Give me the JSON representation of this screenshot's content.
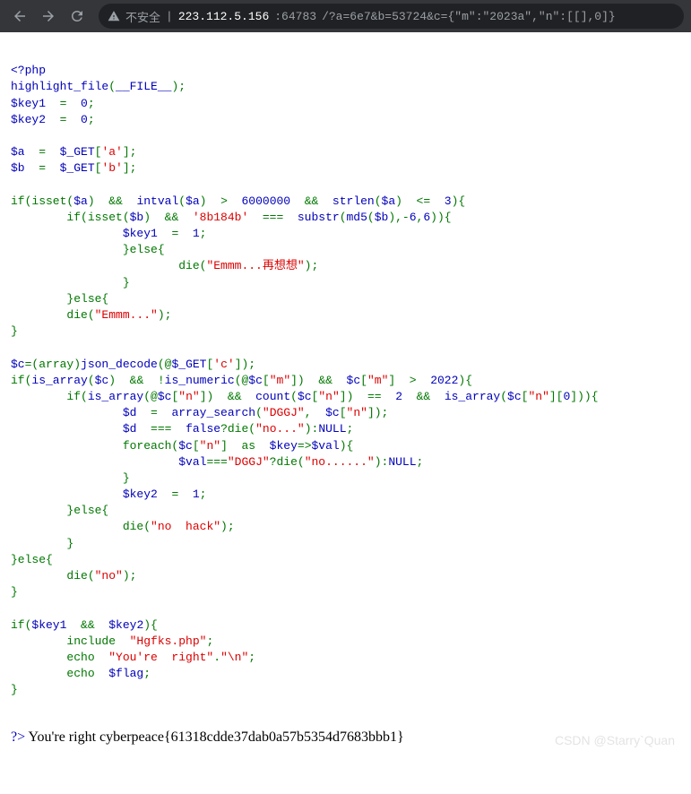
{
  "browser": {
    "insecure_label": "不安全",
    "host": "223.112.5.156",
    "port": ":64783",
    "path": "/?a=6e7&b=53724&c={\"m\":\"2023a\",\"n\":[[],0]}"
  },
  "code": {
    "open": "<?php",
    "l1a": "highlight_file",
    "l1b": "(",
    "l1c": "__FILE__",
    "l1d": ");",
    "l2a": "$key1  ",
    "l2b": "=  ",
    "l2c": "0",
    "l2d": ";",
    "l3a": "$key2  ",
    "l3b": "=  ",
    "l3c": "0",
    "l3d": ";",
    "l5a": "$a  ",
    "l5b": "=  ",
    "l5c": "$_GET",
    "l5d": "[",
    "l5e": "'a'",
    "l5f": "];",
    "l6a": "$b  ",
    "l6b": "=  ",
    "l6c": "$_GET",
    "l6d": "[",
    "l6e": "'b'",
    "l6f": "];",
    "l8a": "if(isset(",
    "l8b": "$a",
    "l8c": ")  &&  ",
    "l8d": "intval",
    "l8e": "(",
    "l8f": "$a",
    "l8g": ")  >  ",
    "l8h": "6000000  ",
    "l8i": "&&  ",
    "l8j": "strlen",
    "l8k": "(",
    "l8l": "$a",
    "l8m": ")  <=  ",
    "l8n": "3",
    "l8o": "){",
    "l9a": "        if(isset(",
    "l9b": "$b",
    "l9c": ")  &&  ",
    "l9d": "'8b184b'  ",
    "l9e": "===  ",
    "l9f": "substr",
    "l9g": "(",
    "l9h": "md5",
    "l9i": "(",
    "l9j": "$b",
    "l9k": "),-",
    "l9l": "6",
    "l9m": ",",
    "l9n": "6",
    "l9o": ")){",
    "l10a": "                ",
    "l10b": "$key1  ",
    "l10c": "=  ",
    "l10d": "1",
    "l10e": ";",
    "l11": "                }else{",
    "l12a": "                        die(",
    "l12b": "\"Emmm...再想想\"",
    "l12c": ");",
    "l13": "                }",
    "l14": "        }else{",
    "l15a": "        die(",
    "l15b": "\"Emmm...\"",
    "l15c": ");",
    "l16": "}",
    "l18a": "$c",
    "l18b": "=(array)",
    "l18c": "json_decode",
    "l18d": "(@",
    "l18e": "$_GET",
    "l18f": "[",
    "l18g": "'c'",
    "l18h": "]);",
    "l19a": "if(",
    "l19b": "is_array",
    "l19c": "(",
    "l19d": "$c",
    "l19e": ")  &&  !",
    "l19f": "is_numeric",
    "l19g": "(@",
    "l19h": "$c",
    "l19i": "[",
    "l19j": "\"m\"",
    "l19k": "])  &&  ",
    "l19l": "$c",
    "l19m": "[",
    "l19n": "\"m\"",
    "l19o": "]  >  ",
    "l19p": "2022",
    "l19q": "){",
    "l20a": "        if(",
    "l20b": "is_array",
    "l20c": "(@",
    "l20d": "$c",
    "l20e": "[",
    "l20f": "\"n\"",
    "l20g": "])  &&  ",
    "l20h": "count",
    "l20i": "(",
    "l20j": "$c",
    "l20k": "[",
    "l20l": "\"n\"",
    "l20m": "])  ==  ",
    "l20n": "2  ",
    "l20o": "&&  ",
    "l20p": "is_array",
    "l20q": "(",
    "l20r": "$c",
    "l20s": "[",
    "l20t": "\"n\"",
    "l20u": "][",
    "l20v": "0",
    "l20w": "])){",
    "l21a": "                ",
    "l21b": "$d  ",
    "l21c": "=  ",
    "l21d": "array_search",
    "l21e": "(",
    "l21f": "\"DGGJ\"",
    "l21g": ",  ",
    "l21h": "$c",
    "l21i": "[",
    "l21j": "\"n\"",
    "l21k": "]);",
    "l22a": "                ",
    "l22b": "$d  ",
    "l22c": "===  ",
    "l22d": "false",
    "l22e": "?die(",
    "l22f": "\"no...\"",
    "l22g": "):",
    "l22h": "NULL",
    "l22i": ";",
    "l23a": "                foreach(",
    "l23b": "$c",
    "l23c": "[",
    "l23d": "\"n\"",
    "l23e": "]  as  ",
    "l23f": "$key",
    "l23g": "=>",
    "l23h": "$val",
    "l23i": "){",
    "l24a": "                        ",
    "l24b": "$val",
    "l24c": "===",
    "l24d": "\"DGGJ\"",
    "l24e": "?die(",
    "l24f": "\"no......\"",
    "l24g": "):",
    "l24h": "NULL",
    "l24i": ";",
    "l25": "                }",
    "l26a": "                ",
    "l26b": "$key2  ",
    "l26c": "=  ",
    "l26d": "1",
    "l26e": ";",
    "l27": "        }else{",
    "l28a": "                die(",
    "l28b": "\"no  hack\"",
    "l28c": ");",
    "l29": "        }",
    "l30": "}else{",
    "l31a": "        die(",
    "l31b": "\"no\"",
    "l31c": ");",
    "l32": "}",
    "l34a": "if(",
    "l34b": "$key1  ",
    "l34c": "&&  ",
    "l34d": "$key2",
    "l34e": "){",
    "l35a": "        include  ",
    "l35b": "\"Hgfks.php\"",
    "l35c": ";",
    "l36a": "        echo  ",
    "l36b": "\"You're  right\"",
    "l36c": ".",
    "l36d": "\"\\n\"",
    "l36e": ";",
    "l37a": "        echo  ",
    "l37b": "$flag",
    "l37c": ";",
    "l38": "}",
    "close": "?>"
  },
  "output": " You're right cyberpeace{61318cdde37dab0a57b5354d7683bbb1}",
  "watermark": "CSDN @Starry`Quan"
}
